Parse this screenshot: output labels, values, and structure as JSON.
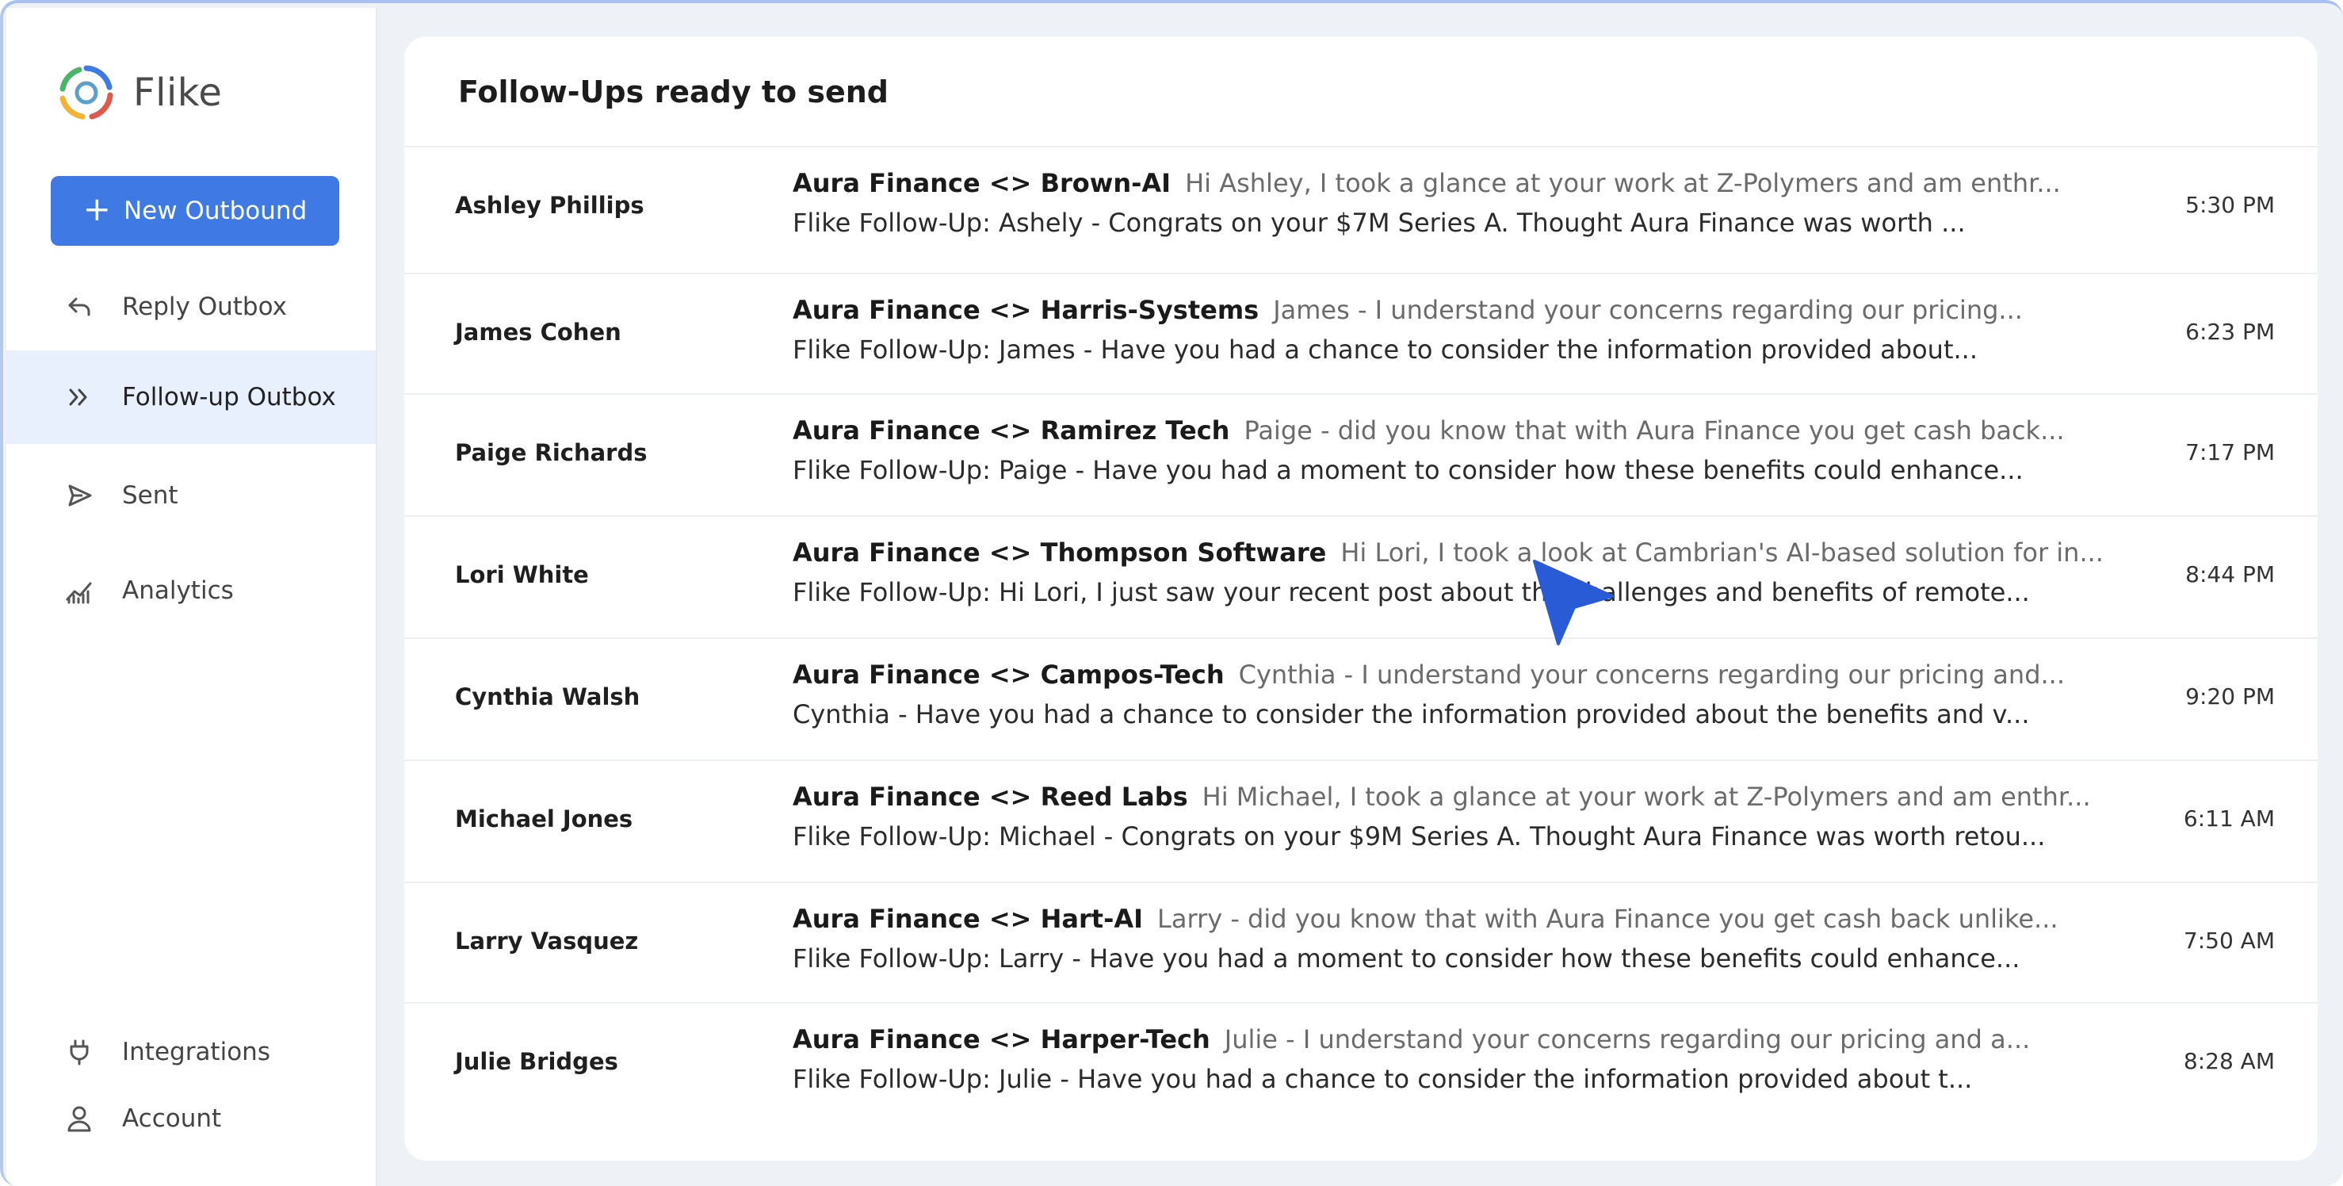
{
  "app": {
    "name": "Flike"
  },
  "sidebar": {
    "new_button_label": "New Outbound",
    "items": [
      {
        "label": "Reply Outbox",
        "icon": "reply-icon"
      },
      {
        "label": "Follow-up Outbox",
        "icon": "double-chevron-right-icon"
      },
      {
        "label": "Sent",
        "icon": "send-icon"
      },
      {
        "label": "Analytics",
        "icon": "analytics-icon"
      }
    ],
    "bottom_items": [
      {
        "label": "Integrations",
        "icon": "plug-icon"
      },
      {
        "label": "Account",
        "icon": "user-icon"
      }
    ]
  },
  "main": {
    "title": "Follow-Ups ready to send",
    "rows": [
      {
        "name": "Ashley Phillips",
        "subject": "Aura Finance <> Brown-AI",
        "preview": "Hi Ashley, I took a glance at your work at Z-Polymers and am enthr...",
        "followup": "Flike Follow-Up: Ashely - Congrats on your $7M Series A. Thought Aura Finance was worth ...",
        "time": "5:30 PM"
      },
      {
        "name": "James Cohen",
        "subject": "Aura Finance <> Harris-Systems",
        "preview": "James - I understand your concerns regarding our pricing...",
        "followup": "Flike Follow-Up: James - Have you had a chance to consider the information provided about...",
        "time": "6:23 PM"
      },
      {
        "name": "Paige Richards",
        "subject": "Aura Finance <> Ramirez Tech",
        "preview": "Paige - did you know that with Aura Finance you get cash back...",
        "followup": "Flike Follow-Up:  Paige - Have you had a moment to consider how these benefits could enhance...",
        "time": "7:17 PM"
      },
      {
        "name": "Lori White",
        "subject": "Aura Finance <> Thompson Software",
        "preview": "Hi Lori, I took a look at Cambrian's AI-based solution for in...",
        "followup": "Flike Follow-Up:  Hi Lori, I just saw your recent post about the challenges and benefits of remote...",
        "time": "8:44 PM"
      },
      {
        "name": "Cynthia Walsh",
        "subject": "Aura Finance <> Campos-Tech",
        "preview": "Cynthia - I understand your concerns regarding our pricing and...",
        "followup": "Cynthia - Have you had a chance to consider the information provided about the benefits and v...",
        "time": "9:20 PM"
      },
      {
        "name": "Michael Jones",
        "subject": "Aura Finance <> Reed Labs",
        "preview": "Hi Michael, I took a glance at your work at Z-Polymers and am enthr...",
        "followup": "Flike Follow-Up: Michael - Congrats on your $9M Series A. Thought Aura Finance was worth retou...",
        "time": "6:11 AM"
      },
      {
        "name": "Larry Vasquez",
        "subject": "Aura Finance <> Hart-AI",
        "preview": "Larry - did you know that with Aura Finance you get cash back unlike...",
        "followup": "Flike Follow-Up:  Larry - Have you had a moment to consider how these benefits could enhance...",
        "time": "7:50 AM"
      },
      {
        "name": "Julie Bridges",
        "subject": "Aura Finance <> Harper-Tech",
        "preview": "Julie - I understand your concerns regarding our pricing and a...",
        "followup": "Flike Follow-Up: Julie - Have you had a chance to consider the information provided about t...",
        "time": "8:28 AM"
      }
    ]
  },
  "colors": {
    "accent": "#3f7ae4",
    "active_nav_bg": "#e8effd",
    "cursor": "#2a5bd7"
  }
}
